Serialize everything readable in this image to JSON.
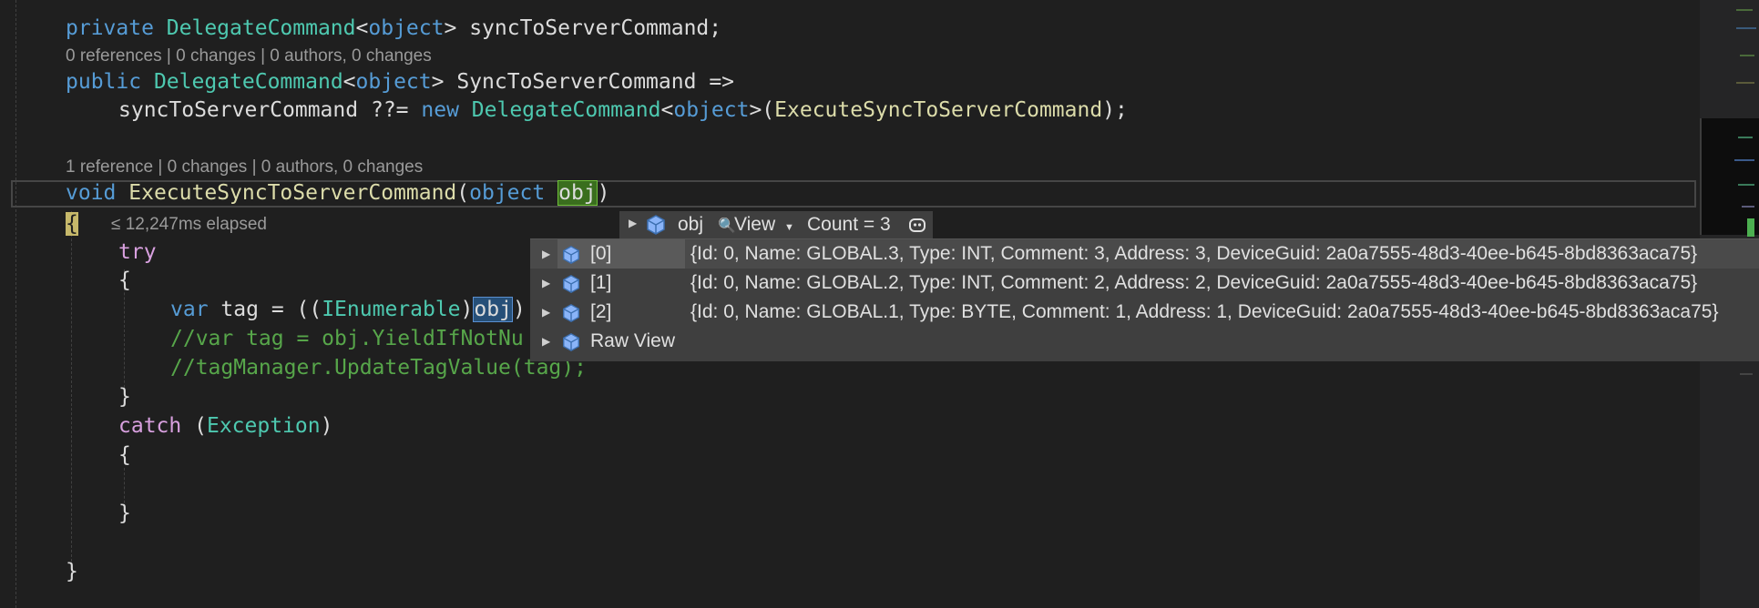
{
  "code": {
    "l1": {
      "kw": "private",
      "type": "DelegateCommand",
      "lt": "<",
      "kw2": "object",
      "gt": ">",
      "id": "syncToServerCommand;"
    },
    "lens1": "0 references | 0 changes | 0 authors, 0 changes",
    "l2": {
      "kw": "public",
      "type": "DelegateCommand",
      "lt": "<",
      "kw2": "object",
      "gt": ">",
      "id": "SyncToServerCommand",
      "arrow": "=>"
    },
    "l3": {
      "id": "syncToServerCommand",
      "op": "??=",
      "kw": "new",
      "type": "DelegateCommand",
      "lt": "<",
      "kw2": "object",
      "gt": ">(",
      "fn": "ExecuteSyncToServerCommand",
      "end": ");"
    },
    "lens2": "1 reference | 0 changes | 0 authors, 0 changes",
    "l4": {
      "kw": "void",
      "fn": "ExecuteSyncToServerCommand",
      "open": "(",
      "kw2": "object",
      "param": "obj",
      "close": ")"
    },
    "brace_open": "{",
    "elapsed": "≤ 12,247ms elapsed",
    "try": "try",
    "brace": "{",
    "l_var": {
      "kw": "var",
      "id": "tag",
      "eq": "= ((",
      "type": "IEnumerable",
      "close": ")",
      "sel": "obj",
      "rest": ")"
    },
    "comment1": "//var tag = obj.YieldIfNotNu",
    "comment2": "//tagManager.UpdateTagValue(tag);",
    "brace_close": "}",
    "catch": "catch",
    "catch_open": "(",
    "catch_type": "Exception",
    "catch_close": ")",
    "brace2": "{",
    "brace2_close": "}",
    "brace_final": "}"
  },
  "datatip": {
    "var_name": "obj",
    "view_label": "View",
    "count_label": "Count = 3",
    "rows": [
      {
        "name": "[0]",
        "value": "{Id: 0, Name: GLOBAL.3, Type: INT, Comment: 3, Address: 3, DeviceGuid: 2a0a7555-48d3-40ee-b645-8bd8363aca75}"
      },
      {
        "name": "[1]",
        "value": "{Id: 0, Name: GLOBAL.2, Type: INT, Comment: 2, Address: 2, DeviceGuid: 2a0a7555-48d3-40ee-b645-8bd8363aca75}"
      },
      {
        "name": "[2]",
        "value": "{Id: 0, Name: GLOBAL.1, Type: BYTE, Comment: 1, Address: 1, DeviceGuid: 2a0a7555-48d3-40ee-b645-8bd8363aca75}"
      },
      {
        "name": "Raw View",
        "value": ""
      }
    ]
  },
  "colors": {
    "keyword": "#569cd6",
    "type": "#4ec9b0",
    "method": "#dcdcaa",
    "comment": "#57a64a",
    "control": "#d8a0df",
    "background": "#1f1f1f"
  }
}
